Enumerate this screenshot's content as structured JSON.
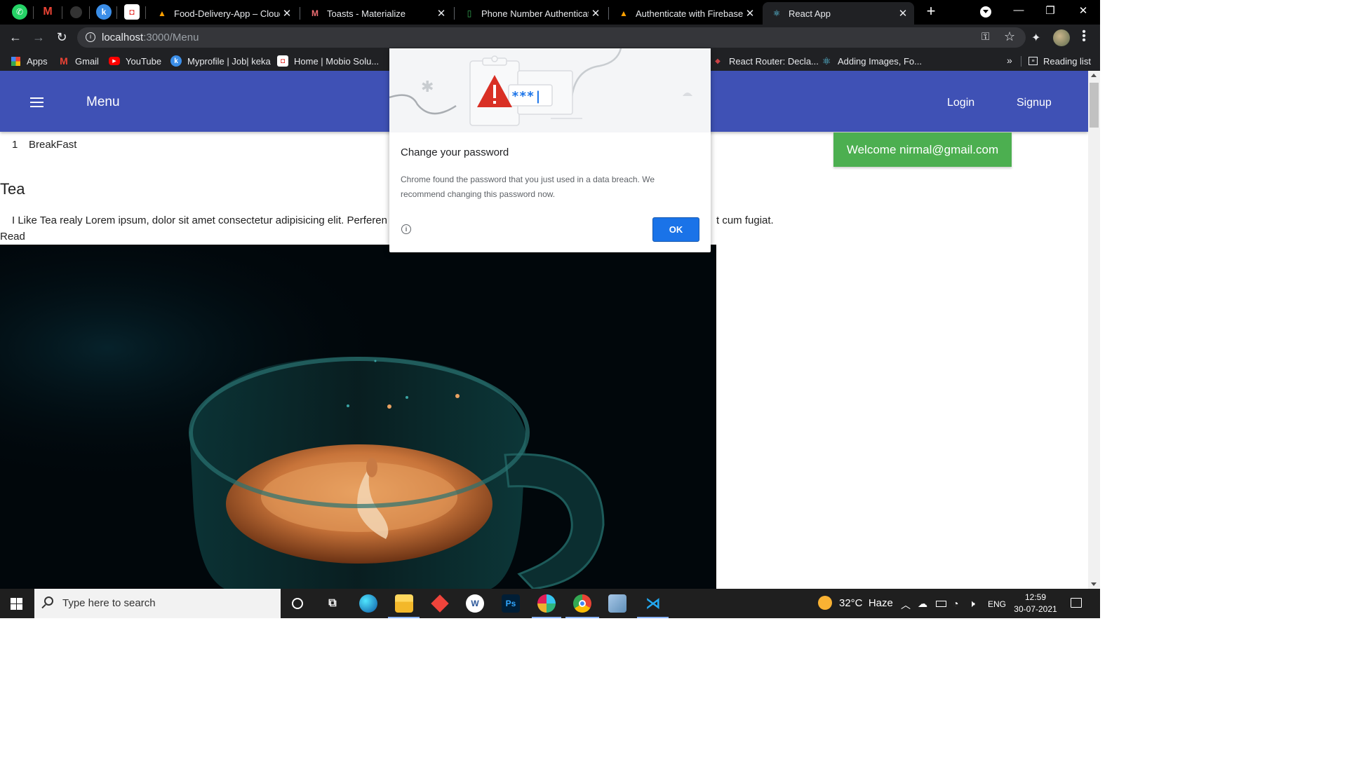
{
  "browser": {
    "tabs": [
      {
        "title": "Food-Delivery-App – Cloud F",
        "icon": "firebase-icon",
        "active": false
      },
      {
        "title": "Toasts - Materialize",
        "icon": "materialize-icon",
        "active": false
      },
      {
        "title": "Phone Number Authenticatio",
        "icon": "phone-auth-icon",
        "active": false
      },
      {
        "title": "Authenticate with Firebase u",
        "icon": "firebase-icon",
        "active": false
      },
      {
        "title": "React App",
        "icon": "react-icon",
        "active": true
      }
    ],
    "pinned_tabs": [
      "whatsapp-icon",
      "gmail-icon",
      "github-icon",
      "keka-icon",
      "mobio-icon"
    ],
    "new_tab_label": "+",
    "address": {
      "host": "localhost",
      "path": ":3000/Menu"
    },
    "bookmarks": [
      {
        "label": "Apps",
        "icon": "apps-grid-icon"
      },
      {
        "label": "Gmail",
        "icon": "gmail-icon"
      },
      {
        "label": "YouTube",
        "icon": "youtube-icon"
      },
      {
        "label": "Myprofile | Job| keka",
        "icon": "keka-icon"
      },
      {
        "label": "Home | Mobio Solu...",
        "icon": "mobio-icon"
      },
      {
        "label": "React Router: Decla...",
        "icon": "react-router-icon"
      },
      {
        "label": "Adding Images, Fo...",
        "icon": "react-icon"
      }
    ],
    "bookmarks_more": "»",
    "reading_list": "Reading list"
  },
  "app": {
    "brand": "Menu",
    "nav_links": [
      "Login",
      "Signup"
    ],
    "welcome_toast": "Welcome nirmal@gmail.com",
    "category": {
      "number": "1",
      "name": "BreakFast"
    },
    "item": {
      "title": "Tea",
      "description": "I Like Tea realy Lorem ipsum, dolor sit amet consectetur adipisicing elit. Perferen",
      "description_tail": "t cum fugiat.",
      "read_label": "Read"
    }
  },
  "dialog": {
    "title": "Change your password",
    "body": "Chrome found the password that you just used in a data breach. We recommend changing this password now.",
    "ok_label": "OK",
    "illustration_text": "***|"
  },
  "taskbar": {
    "search_placeholder": "Type here to search",
    "weather": "32°C  Haze",
    "language": "ENG",
    "time": "12:59",
    "date": "30-07-2021",
    "apps": [
      "cortana-icon",
      "task-view-icon",
      "edge-icon",
      "file-explorer-icon",
      "anydesk-icon",
      "word-online-icon",
      "photoshop-icon",
      "slack-icon",
      "chrome-icon",
      "notepad-icon",
      "vscode-icon"
    ]
  },
  "colors": {
    "app_bar": "#3f51b5",
    "toast_green": "#4caf50",
    "ok_blue": "#1a73e8",
    "warning_red": "#d93025"
  }
}
